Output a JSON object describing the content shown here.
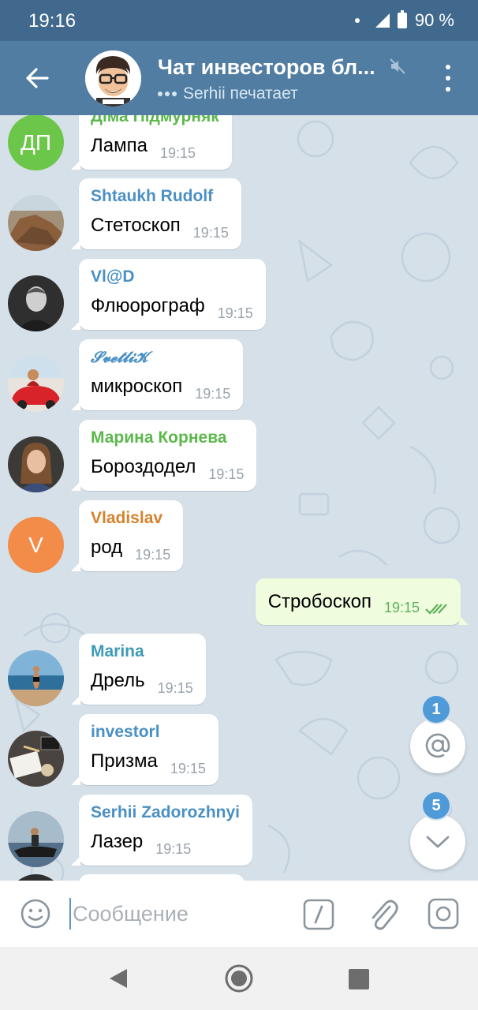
{
  "status_bar": {
    "time": "19:16",
    "battery": "90 %"
  },
  "header": {
    "title": "Чат инвесторов бл...",
    "status": "Serhii печатает"
  },
  "colors": {
    "header": "#517da2",
    "status_bar": "#41698d",
    "accent": "#4f9ad9",
    "outgoing_bubble": "#effdde"
  },
  "messages": [
    {
      "sender": "Діма Підмурняк",
      "sender_color": "#5cb84c",
      "text": "Лампа",
      "time": "19:15",
      "avatar": {
        "kind": "initials",
        "initials": "ДП",
        "color": "#6cc64a"
      }
    },
    {
      "sender": "Shtaukh Rudolf",
      "sender_color": "#4a90c4",
      "text": "Стетоскоп",
      "time": "19:15",
      "avatar": {
        "kind": "photo",
        "icon": "rock-photo"
      }
    },
    {
      "sender": "Vl@D",
      "sender_color": "#4a90c4",
      "text": "Флюорограф",
      "time": "19:15",
      "avatar": {
        "kind": "photo",
        "icon": "man-photo"
      }
    },
    {
      "sender": "𝓢𝓿𝓮𝓽𝓵𝓲𝓚",
      "sender_color": "#4a90c4",
      "text": "микроскоп",
      "time": "19:15",
      "avatar": {
        "kind": "photo",
        "icon": "car-photo"
      }
    },
    {
      "sender": "Марина Корнева",
      "sender_color": "#5cb84c",
      "text": "Бороздодел",
      "time": "19:15",
      "avatar": {
        "kind": "photo",
        "icon": "woman-photo"
      }
    },
    {
      "sender": "Vladislav",
      "sender_color": "#d7822d",
      "text": "род",
      "time": "19:15",
      "avatar": {
        "kind": "initials",
        "initials": "V",
        "color": "#f28c48"
      }
    },
    {
      "sender": "Marina",
      "sender_color": "#3d9ab5",
      "text": "Дрель",
      "time": "19:15",
      "avatar": {
        "kind": "photo",
        "icon": "beach-photo"
      }
    },
    {
      "sender": "investorl",
      "sender_color": "#4a90c4",
      "text": "Призма",
      "time": "19:15",
      "avatar": {
        "kind": "photo",
        "icon": "desk-photo"
      }
    },
    {
      "sender": "Serhii Zadorozhnyi",
      "sender_color": "#4a90c4",
      "text": "Лазер",
      "time": "19:15",
      "avatar": {
        "kind": "photo",
        "icon": "jetski-photo"
      }
    }
  ],
  "outgoing": {
    "text": "Стробоскоп",
    "time": "19:15"
  },
  "badges": {
    "mentions": "1",
    "unread": "5"
  },
  "input": {
    "placeholder": "Сообщение",
    "value": ""
  }
}
